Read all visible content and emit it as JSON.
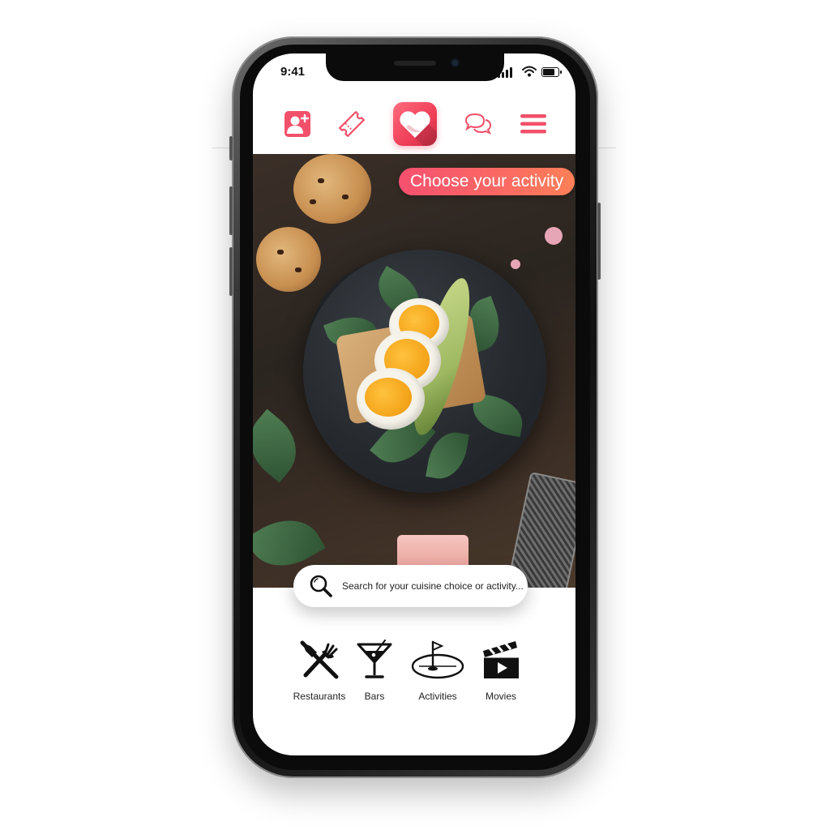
{
  "status_bar": {
    "time": "9:41",
    "battery_level": 0.9
  },
  "top_nav": {
    "items": [
      {
        "icon": "add-user-icon"
      },
      {
        "icon": "ticket-icon"
      },
      {
        "icon": "heart-logo-icon"
      },
      {
        "icon": "chat-bubbles-icon"
      },
      {
        "icon": "hamburger-menu-icon"
      }
    ],
    "accent_color": "#f2506a"
  },
  "hero": {
    "activity_label": "Choose your activity"
  },
  "search": {
    "placeholder": "Search for your cuisine choice or activity...",
    "value": ""
  },
  "categories": [
    {
      "label": "Restaurants",
      "icon": "fork-knife-icon"
    },
    {
      "label": "Bars",
      "icon": "cocktail-glass-icon"
    },
    {
      "label": "Activities",
      "icon": "golf-flag-icon"
    },
    {
      "label": "Movies",
      "icon": "clapperboard-icon"
    }
  ]
}
